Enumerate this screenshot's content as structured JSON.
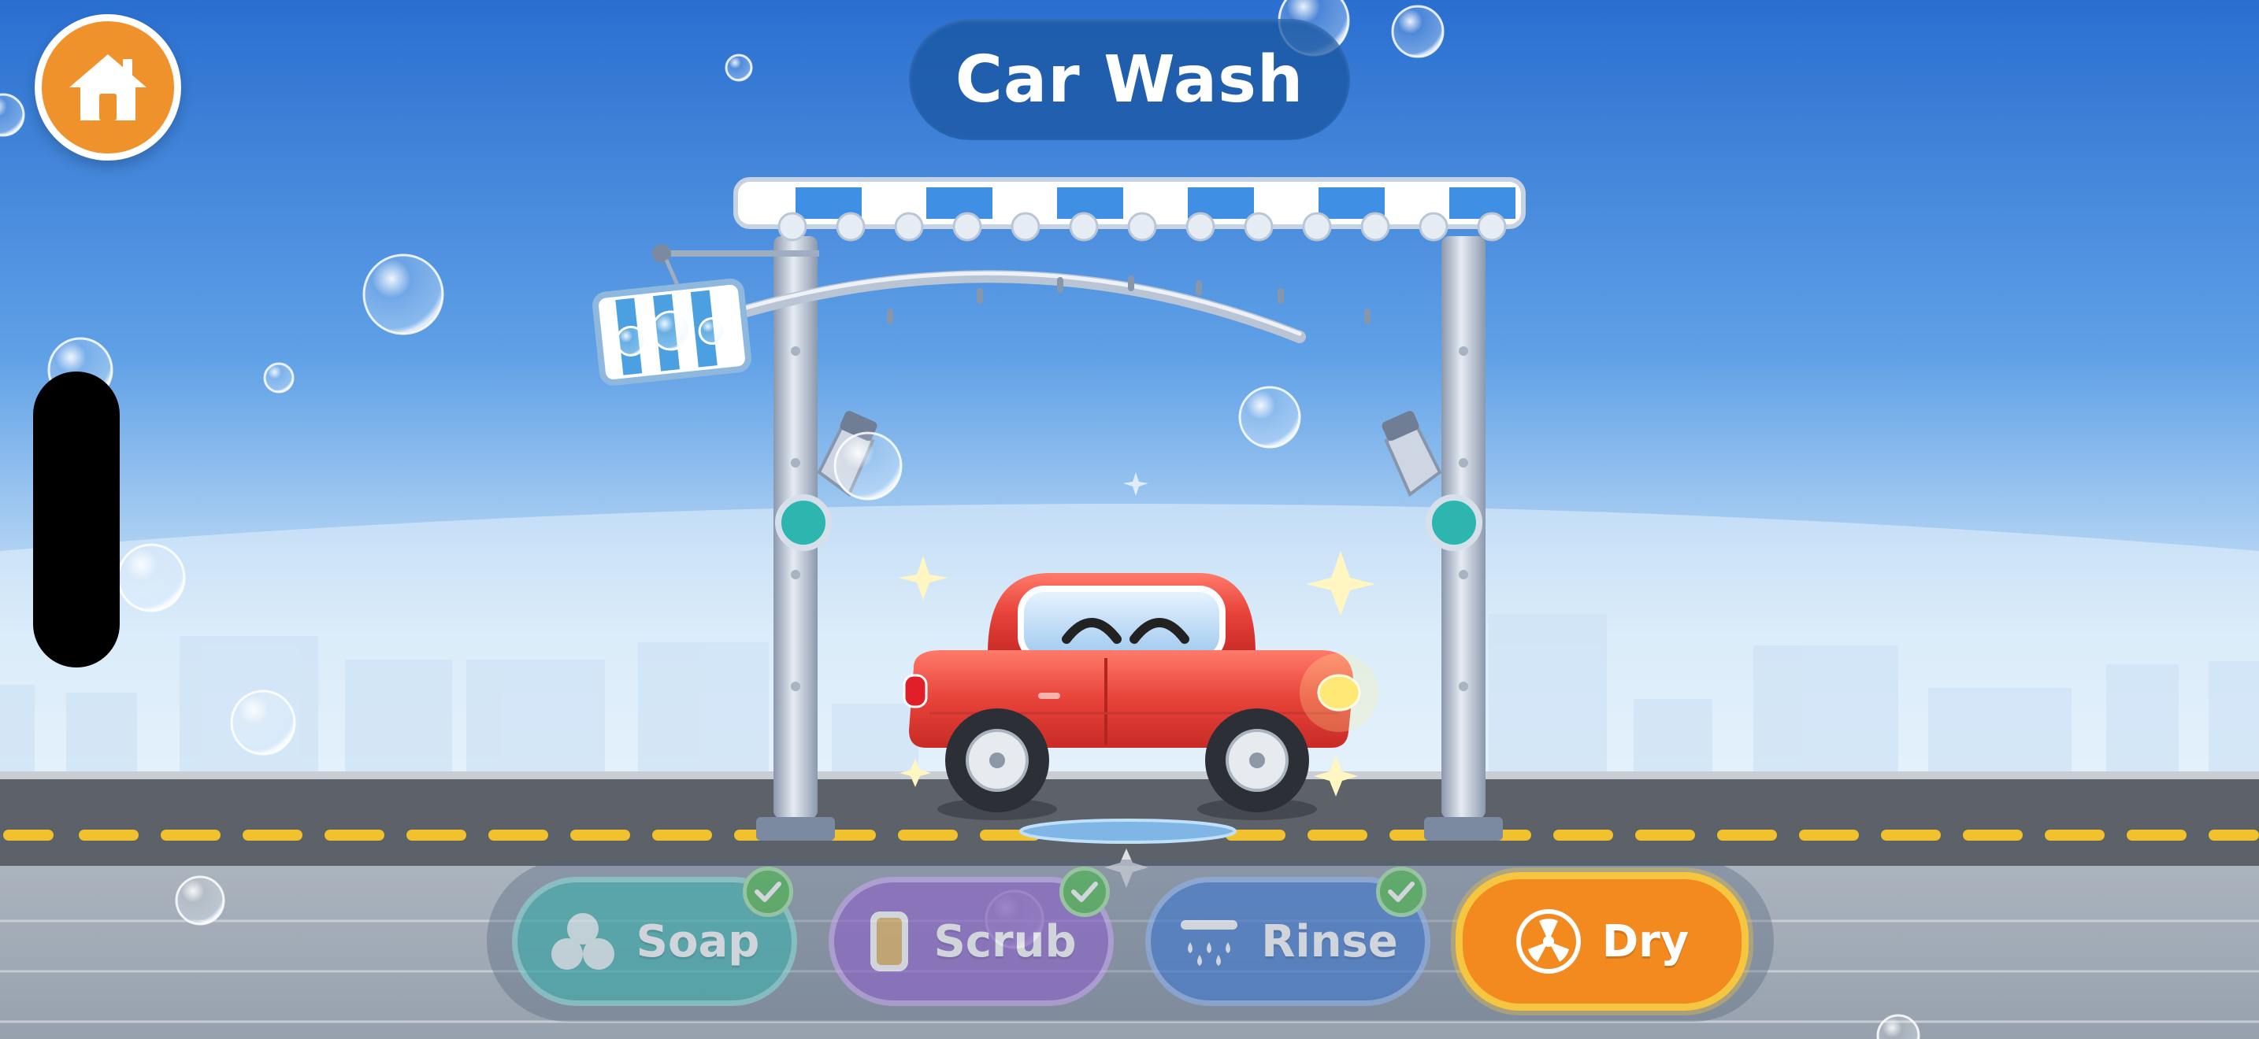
{
  "header": {
    "title": "Car Wash"
  },
  "nav": {
    "home_icon": "home-icon"
  },
  "tools": [
    {
      "label": "Soap",
      "icon": "bubbles-icon",
      "completed": true,
      "color": "#3fb0ad"
    },
    {
      "label": "Scrub",
      "icon": "sponge-icon",
      "completed": true,
      "color": "#8d62c9"
    },
    {
      "label": "Rinse",
      "icon": "shower-icon",
      "completed": true,
      "color": "#3f78cf"
    },
    {
      "label": "Dry",
      "icon": "fan-icon",
      "completed": false,
      "active": true,
      "color": "#f28a1f"
    }
  ],
  "colors": {
    "sky_top": "#2a6fd0",
    "sky_bottom": "#dbeefa",
    "car": "#e8433a",
    "road": "#5d6269",
    "lane": "#f2c22e",
    "accent": "#f0922b"
  }
}
